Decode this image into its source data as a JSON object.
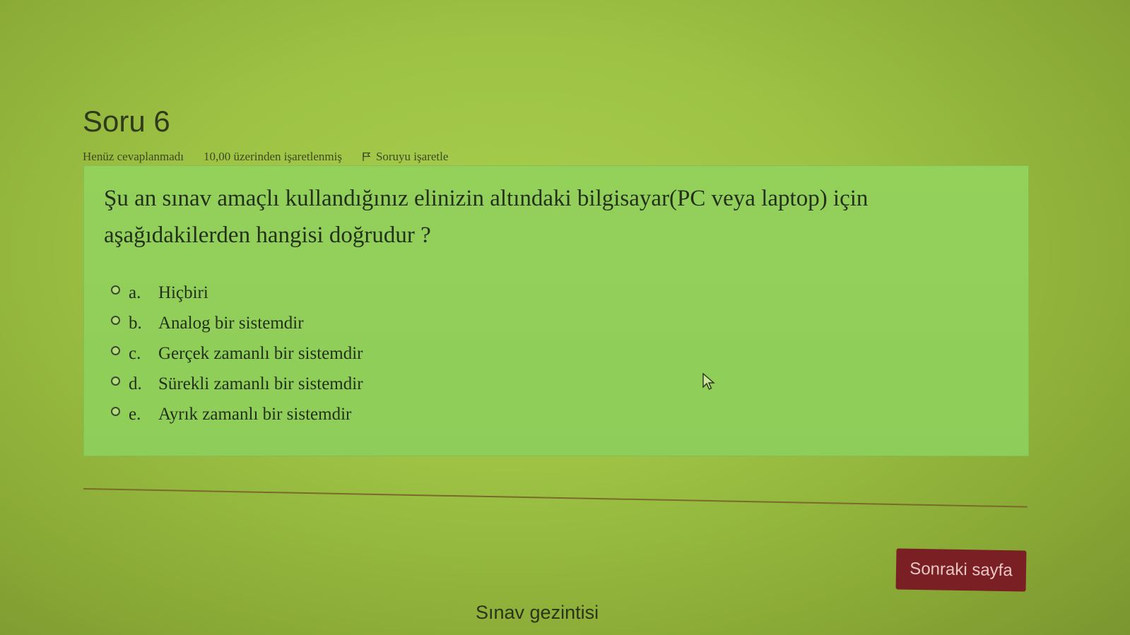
{
  "question": {
    "title": "Soru 6",
    "status": "Henüz cevaplanmadı",
    "marks": "10,00 üzerinden işaretlenmiş",
    "flag_label": "Soruyu işaretle",
    "text": "Şu an sınav amaçlı kullandığınız elinizin altındaki bilgisayar(PC veya laptop) için aşağıdakilerden hangisi doğrudur ?",
    "answers": [
      {
        "letter": "a.",
        "label": "Hiçbiri"
      },
      {
        "letter": "b.",
        "label": "Analog bir sistemdir"
      },
      {
        "letter": "c.",
        "label": "Gerçek zamanlı bir sistemdir"
      },
      {
        "letter": "d.",
        "label": "Sürekli zamanlı bir sistemdir"
      },
      {
        "letter": "e.",
        "label": "Ayrık zamanlı bir sistemdir"
      }
    ]
  },
  "footer": {
    "next_label": "Sonraki sayfa",
    "nav_title": "Sınav gezintisi"
  },
  "icons": {
    "flag": "flag-icon",
    "cursor": "cursor-icon"
  },
  "colors": {
    "background": "#9dc244",
    "question_box": "#93d15b",
    "next_button": "#7a1f24"
  }
}
